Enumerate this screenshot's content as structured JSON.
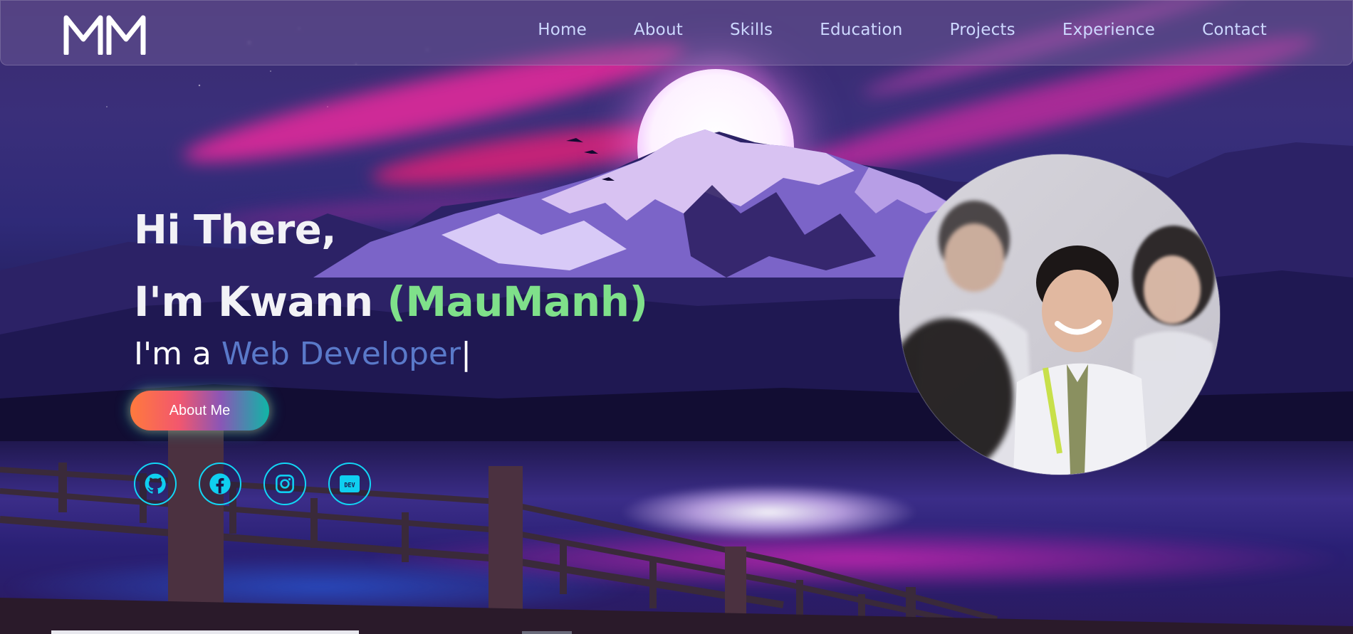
{
  "brand": {
    "logo_text": "MM"
  },
  "nav": {
    "items": [
      {
        "label": "Home"
      },
      {
        "label": "About"
      },
      {
        "label": "Skills"
      },
      {
        "label": "Education"
      },
      {
        "label": "Projects"
      },
      {
        "label": "Experience"
      },
      {
        "label": "Contact"
      }
    ]
  },
  "hero": {
    "greeting": "Hi There,",
    "name_prefix": "I'm Kwann ",
    "alias": "(MauManh)",
    "role_prefix": "I'm a ",
    "role": "Web Developer",
    "caret": "|",
    "cta_label": "About Me"
  },
  "socials": [
    {
      "icon": "github-icon"
    },
    {
      "icon": "facebook-icon"
    },
    {
      "icon": "instagram-icon"
    },
    {
      "icon": "dev-icon",
      "text": "DEV"
    }
  ],
  "colors": {
    "alias_green": "#7fe08a",
    "role_blue": "#5a79c9",
    "social_ring": "#12d6f5",
    "nav_text": "#cdd8ff"
  }
}
